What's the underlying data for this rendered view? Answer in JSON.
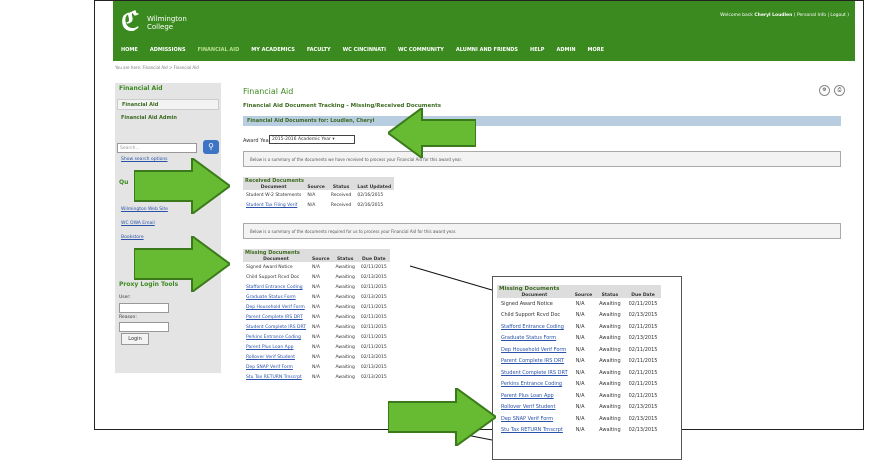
{
  "header": {
    "logo_line1": "Wilmington",
    "logo_line2": "College",
    "welcome_text": "Welcome back",
    "welcome_name": "Cheryl Loudlen",
    "welcome_links": "( Personal Info | Logout )",
    "nav": [
      "HOME",
      "ADMISSIONS",
      "FINANCIAL AID",
      "MY ACADEMICS",
      "FACULTY",
      "WC CINCINNATI",
      "WC COMMUNITY",
      "ALUMNI AND FRIENDS",
      "HELP",
      "ADMIN",
      "MORE"
    ]
  },
  "breadcrumb": "You are here: Financial Aid > Financial Aid",
  "sidebar": {
    "title": "Financial Aid",
    "item1": "Financial Aid",
    "item2": "Financial Aid Admin",
    "search_placeholder": "Search...",
    "search_options": "Show search options",
    "quicklinks_title": "Qu",
    "quicklinks": [
      "Wilmington Web Site",
      "WC OWA Email",
      "Bookstore"
    ],
    "proxy_title": "Proxy Login Tools",
    "user_label": "User:",
    "reason_label": "Reason:",
    "login_label": "Login"
  },
  "main": {
    "title": "Financial Aid",
    "subtitle": "Financial Aid Document Tracking - Missing/Received Documents",
    "bar_title": "Financial Aid Documents for: Loudlen, Cheryl",
    "award_label": "Award Year:",
    "award_value": "2015-2016 Academic Year",
    "info1": "Below is a summary of the documents we have received to process your Financial Aid for this award year.",
    "info2": "Below is a summary of the documents required for us to process your Financial Aid for this award year."
  },
  "received": {
    "title": "Received Documents",
    "headers": [
      "Document",
      "Source",
      "Status",
      "Last Updated"
    ],
    "rows": [
      [
        "Student W-2 Statements",
        "N/A",
        "Received",
        "02/16/2015"
      ],
      [
        "Student Tax Filing Verif",
        "N/A",
        "Received",
        "02/16/2015"
      ]
    ]
  },
  "missing": {
    "title": "Missing Documents",
    "headers": [
      "Document",
      "Source",
      "Status",
      "Due Date"
    ],
    "rows": [
      [
        "Signed Award Notice",
        "N/A",
        "Awaiting",
        "02/11/2015"
      ],
      [
        "Child Support Rcvd Doc",
        "N/A",
        "Awaiting",
        "02/13/2015"
      ],
      [
        "Stafford Entrance Coding",
        "N/A",
        "Awaiting",
        "02/11/2015"
      ],
      [
        "Graduate Status Form",
        "N/A",
        "Awaiting",
        "02/13/2015"
      ],
      [
        "Dep Household Verif Form",
        "N/A",
        "Awaiting",
        "02/11/2015"
      ],
      [
        "Parent Complete IRS DRT",
        "N/A",
        "Awaiting",
        "02/11/2015"
      ],
      [
        "Student Complete IRS DRT",
        "N/A",
        "Awaiting",
        "02/11/2015"
      ],
      [
        "Perkins Entrance Coding",
        "N/A",
        "Awaiting",
        "02/11/2015"
      ],
      [
        "Parent Plus Loan App",
        "N/A",
        "Awaiting",
        "02/11/2015"
      ],
      [
        "Rollover Verif Student",
        "N/A",
        "Awaiting",
        "02/13/2015"
      ],
      [
        "Dep SNAP Verif Form",
        "N/A",
        "Awaiting",
        "02/13/2015"
      ],
      [
        "Stu Tax RETURN Trnscrpt",
        "N/A",
        "Awaiting",
        "02/13/2015"
      ]
    ],
    "link_rows": [
      false,
      false,
      true,
      true,
      true,
      true,
      true,
      true,
      true,
      true,
      true,
      true
    ]
  },
  "colors": {
    "brand_green": "#3b8a1f",
    "arrow_green": "#66bb33",
    "bar_blue": "#b8cde0"
  }
}
